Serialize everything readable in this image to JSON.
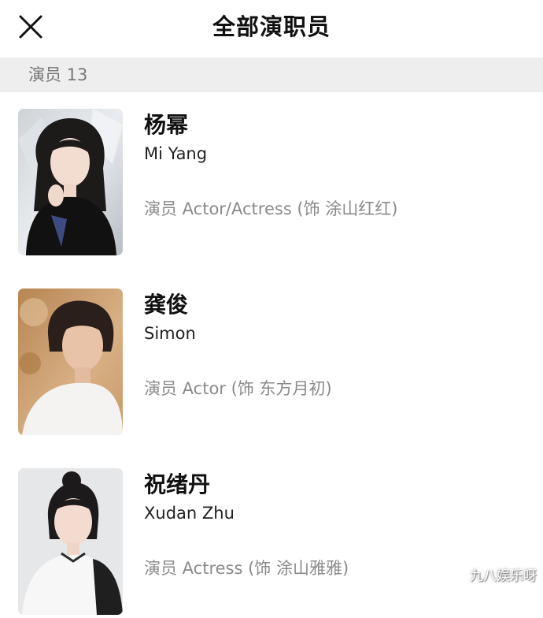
{
  "header": {
    "title": "全部演职员",
    "close_icon": "close-icon"
  },
  "section": {
    "label": "演员 13"
  },
  "cast": [
    {
      "name_cn": "杨幂",
      "name_en": "Mi Yang",
      "role": "演员 Actor/Actress (饰 涂山红红)"
    },
    {
      "name_cn": "龚俊",
      "name_en": "Simon",
      "role": "演员 Actor (饰 东方月初)"
    },
    {
      "name_cn": "祝绪丹",
      "name_en": "Xudan Zhu",
      "role": "演员 Actress (饰 涂山雅雅)"
    }
  ],
  "watermark": "九八娱乐呀"
}
